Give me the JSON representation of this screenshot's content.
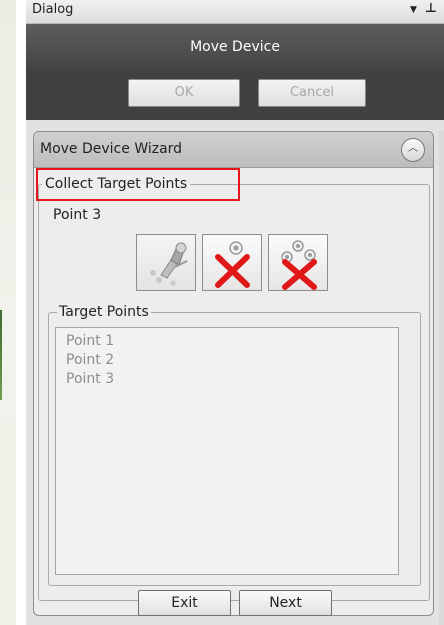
{
  "titlebar": {
    "title": "Dialog",
    "menu_arrow": "▼",
    "pin_glyph": "⊥"
  },
  "header": {
    "title": "Move Device"
  },
  "actions": {
    "ok_label": "OK",
    "cancel_label": "Cancel"
  },
  "wizard": {
    "title": "Move Device Wizard",
    "collapse_glyph": "︿",
    "section_title": "Collect Target Points",
    "current_point": "Point 3",
    "tools": [
      {
        "name": "collect-point",
        "icon": "point-pick-icon"
      },
      {
        "name": "delete-point",
        "icon": "delete-point-icon"
      },
      {
        "name": "delete-all-points",
        "icon": "delete-all-points-icon"
      }
    ],
    "target_points_label": "Target Points",
    "target_points": [
      "Point 1",
      "Point 2",
      "Point 3"
    ],
    "exit_label": "Exit",
    "next_label": "Next"
  },
  "colors": {
    "highlight": "#e8141c",
    "header": "#4f4f4f",
    "delete_x": "#e01818"
  }
}
